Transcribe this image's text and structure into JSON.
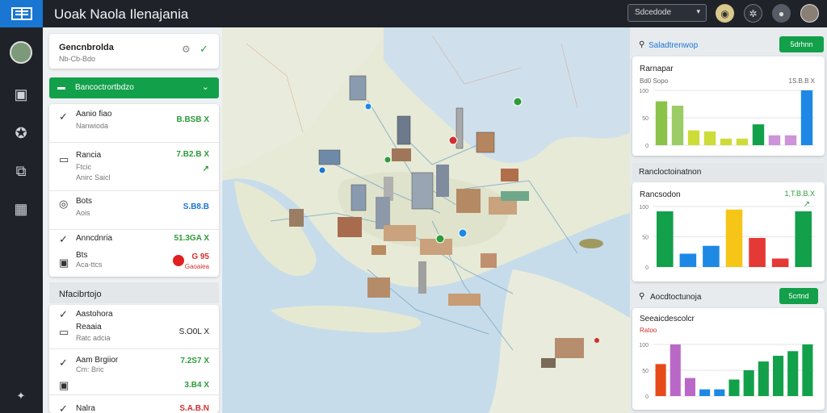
{
  "app": {
    "title": "Uoak Naola Ilenajania"
  },
  "topbar": {
    "select_label": "Sdcedode",
    "select_caret": "▾"
  },
  "sidebar": {
    "items": [
      {
        "icon": "document-icon"
      },
      {
        "icon": "network-icon"
      },
      {
        "icon": "map-icon"
      },
      {
        "icon": "grid-icon"
      },
      {
        "icon": "star-icon"
      }
    ]
  },
  "left_panel": {
    "header": "Gencnbrolda",
    "header_sub": "Nb-Cb-Bdo",
    "banner": "Bancoctrortbdzo",
    "rows": [
      {
        "title": "Aanio fiao",
        "sub": "Nanwioda",
        "value": "B.BSB X",
        "color": "#2e9b3a"
      },
      {
        "title": "Rancia",
        "sub": "Ftcic",
        "value": "7.B2.B X",
        "color": "#2e9b3a",
        "sub2": "Anirc Saicl"
      },
      {
        "title": "Bots",
        "sub": "Aois",
        "value": "S.B8.B",
        "color": "#1976d2"
      },
      {
        "title": "Anncdnria",
        "sub": "",
        "value": "51.3GA X",
        "color": "#2e9b3a"
      },
      {
        "title": "Bts",
        "sub": "Aca-ttcs",
        "value": "G 95",
        "color": "#d32f2f",
        "value_sub": "Gaoaiea"
      }
    ],
    "section2": "Nfacibrtojo",
    "rows2": [
      {
        "title": "Aastohora",
        "sub": "",
        "value": "",
        "color": "#222"
      },
      {
        "title": "Reaaia",
        "sub": "Ratc adcia",
        "value": "S.O0L X",
        "color": "#222"
      },
      {
        "title": "Aam Brgiior",
        "sub": "Cm: Bric",
        "value": "7.2S7 X",
        "color": "#2e9b3a"
      },
      {
        "title": "",
        "sub": "",
        "value": "3.B4 X",
        "color": "#2e9b3a"
      },
      {
        "title": "Nalra",
        "sub": "",
        "value": "S.A.B.N",
        "color": "#d32f2f"
      }
    ]
  },
  "right_panel": {
    "card1": {
      "header": "Saladtrenwop",
      "button": "5drhnn",
      "chart_title": "Rarnapar",
      "left_value": "Bd0 Sopo",
      "right_value": "1S.B.B X"
    },
    "card2": {
      "header": "Rancloctoinatnon",
      "chart_title": "Rancsodon",
      "right_value": "1,T.B.B.X"
    },
    "card3": {
      "header": "Aocdtoctunoja",
      "button": "5crtnd",
      "chart_title": "Seeaicdescolcr",
      "left_value": "Ratoo"
    }
  },
  "chart_data": [
    {
      "type": "bar",
      "title": "Rarnapar",
      "yticks": [
        "100",
        "50",
        "0"
      ],
      "ylim": [
        0,
        100
      ],
      "values": [
        80,
        72,
        27,
        25,
        12,
        12,
        38,
        18,
        18,
        100
      ],
      "colors": [
        "#8bc34a",
        "#9ccc65",
        "#cddc39",
        "#cddc39",
        "#cddc39",
        "#cddc39",
        "#12a04a",
        "#ce93d8",
        "#ce93d8",
        "#1e88e5"
      ]
    },
    {
      "type": "bar",
      "title": "Rancsodon",
      "yticks": [
        "100",
        "50",
        "0"
      ],
      "ylim": [
        0,
        100
      ],
      "values": [
        92,
        22,
        35,
        95,
        48,
        14,
        92
      ],
      "colors": [
        "#12a04a",
        "#1e88e5",
        "#1e88e5",
        "#f5c518",
        "#e53935",
        "#e53935",
        "#12a04a"
      ]
    },
    {
      "type": "bar",
      "title": "Seeaicdescolcr",
      "yticks": [
        "100",
        "50",
        "0"
      ],
      "ylim": [
        0,
        100
      ],
      "values": [
        62,
        100,
        35,
        13,
        13,
        32,
        50,
        67,
        78,
        87,
        100
      ],
      "colors": [
        "#e64a19",
        "#ba68c8",
        "#ba68c8",
        "#1e88e5",
        "#1e88e5",
        "#12a04a",
        "#12a04a",
        "#12a04a",
        "#12a04a",
        "#12a04a",
        "#12a04a"
      ]
    }
  ]
}
